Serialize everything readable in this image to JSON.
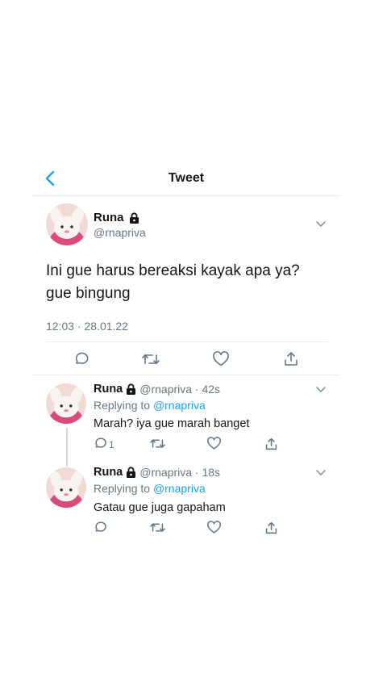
{
  "header": {
    "title": "Tweet"
  },
  "main_tweet": {
    "name": "Runa",
    "handle": "@rnapriva",
    "text_line1": "Ini gue harus bereaksi kayak apa ya?",
    "text_line2": "gue bingung",
    "timestamp": "12:03 · 28.01.22"
  },
  "replies": [
    {
      "name": "Runa",
      "meta": "@rnapriva · 42s",
      "replying_prefix": "Replying to",
      "replying_to": "@rnapriva",
      "text": "Marah? iya gue marah banget",
      "reply_count": "1"
    },
    {
      "name": "Runa",
      "meta": "@rnapriva · 18s",
      "replying_prefix": "Replying to",
      "replying_to": "@rnapriva",
      "text": "Gatau gue juga gapaham",
      "reply_count": ""
    }
  ],
  "icons": {
    "back": "chevron-left-icon",
    "lock": "lock-icon",
    "more": "chevron-down-icon",
    "reply": "comment-icon",
    "retweet": "retweet-icon",
    "like": "heart-icon",
    "share": "share-icon"
  },
  "colors": {
    "accent": "#1da1f2",
    "text": "#14171a",
    "muted": "#657786",
    "divider": "#e6ecf0"
  }
}
